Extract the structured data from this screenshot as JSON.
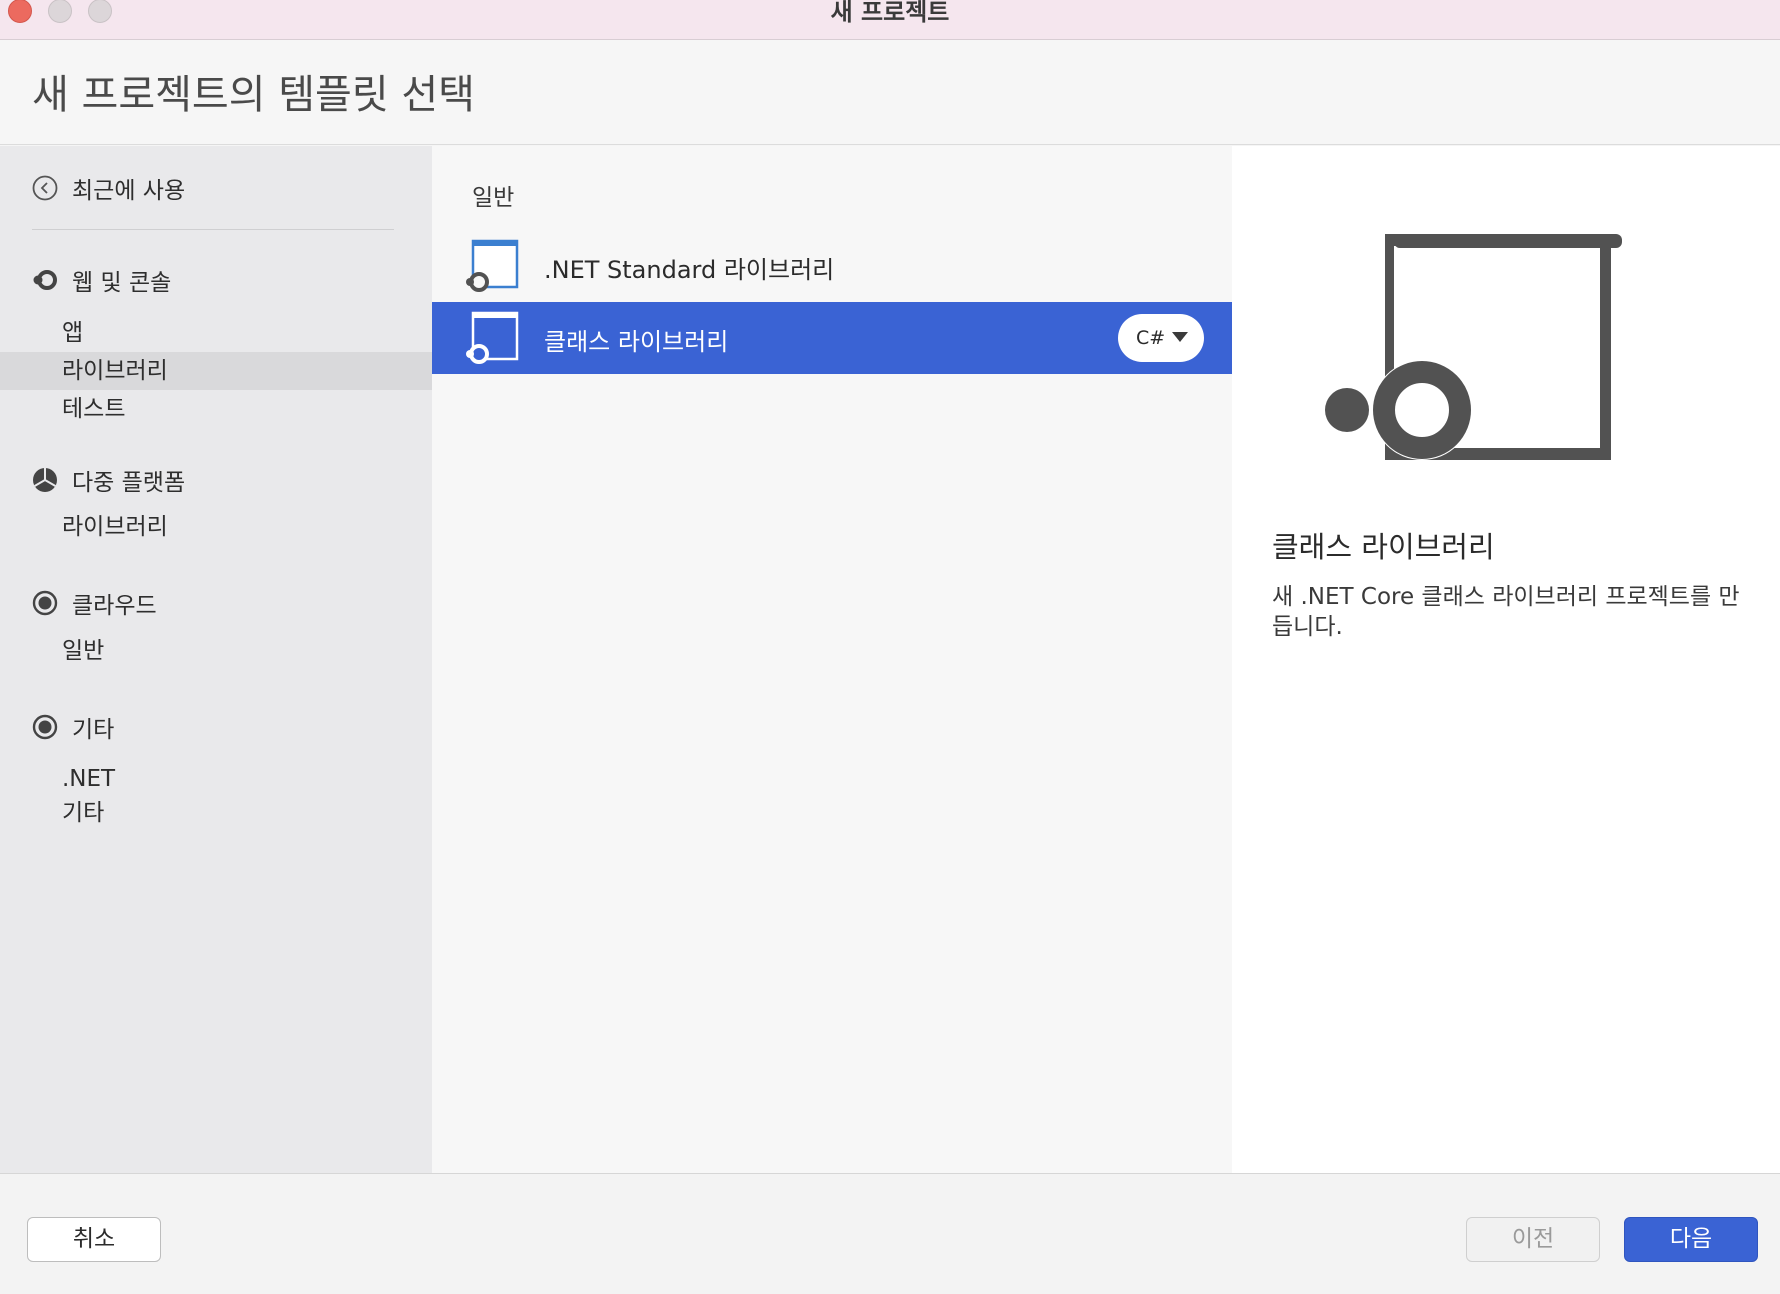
{
  "window": {
    "title": "새 프로젝트"
  },
  "header": {
    "title": "새 프로젝트의 템플릿 선택"
  },
  "sidebar": {
    "recent": {
      "label": "최근에 사용",
      "icon": "back-circle-icon"
    },
    "groups": [
      {
        "label": "웹 및 콘솔",
        "icon": "web-console-icon",
        "items": [
          "앱",
          "라이브러리",
          "테스트"
        ]
      },
      {
        "label": "다중 플랫폼",
        "icon": "multiplatform-icon",
        "items": [
          "라이브러리"
        ]
      },
      {
        "label": "클라우드",
        "icon": "cloud-icon",
        "items": [
          "일반"
        ]
      },
      {
        "label": "기타",
        "icon": "other-icon",
        "items": [
          ".NET",
          "기타"
        ]
      }
    ],
    "selected": "웹 및 콘솔/라이브러리"
  },
  "templates": {
    "section": "일반",
    "items": [
      {
        "label": ".NET Standard 라이브러리",
        "icon": "library-template-icon"
      },
      {
        "label": "클래스 라이브러리",
        "icon": "library-template-icon",
        "language": "C#",
        "selected": true
      }
    ]
  },
  "detail": {
    "title": "클래스 라이브러리",
    "description": "새 .NET Core 클래스 라이브러리 프로젝트를 만듭니다.",
    "icon": "library-template-large-icon"
  },
  "footer": {
    "cancel": "취소",
    "previous": "이전",
    "next": "다음"
  },
  "colors": {
    "accent": "#3a63d4",
    "titlebar": "#f5e6ee",
    "sidebar": "#e9e9eb",
    "icon_blue": "#3b7fd0",
    "icon_gray": "#525252"
  }
}
